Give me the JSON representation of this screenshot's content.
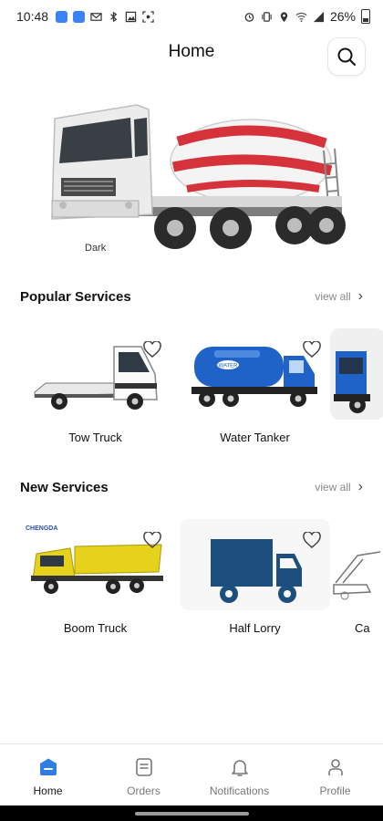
{
  "status_bar": {
    "time": "10:48",
    "battery": "26%"
  },
  "header": {
    "title": "Home"
  },
  "banner": {
    "caption": "Dark"
  },
  "popular_services": {
    "title": "Popular Services",
    "view_all": "view all",
    "items": [
      {
        "label": "Tow Truck",
        "icon": "tow-truck-image"
      },
      {
        "label": "Water Tanker",
        "icon": "water-tanker-image"
      },
      {
        "label": "",
        "icon": "truck-image"
      }
    ]
  },
  "new_services": {
    "title": "New Services",
    "view_all": "view all",
    "items": [
      {
        "label": "Boom Truck",
        "icon": "boom-truck-image",
        "brand": "CHENGDA"
      },
      {
        "label": "Half Lorry",
        "icon": "half-lorry-image"
      },
      {
        "label": "Ca",
        "icon": "crane-image"
      }
    ]
  },
  "water_tank_text": "WATER",
  "bottom_nav": {
    "items": [
      {
        "label": "Home",
        "icon": "home-icon",
        "active": true
      },
      {
        "label": "Orders",
        "icon": "orders-icon",
        "active": false
      },
      {
        "label": "Notifications",
        "icon": "bell-icon",
        "active": false
      },
      {
        "label": "Profile",
        "icon": "profile-icon",
        "active": false
      }
    ]
  },
  "colors": {
    "accent": "#2f7de1",
    "mixer_red": "#d6323b",
    "tanker_blue": "#1f63c9",
    "lorry_navy": "#1c4f7e",
    "boom_yellow": "#e6d21b"
  }
}
